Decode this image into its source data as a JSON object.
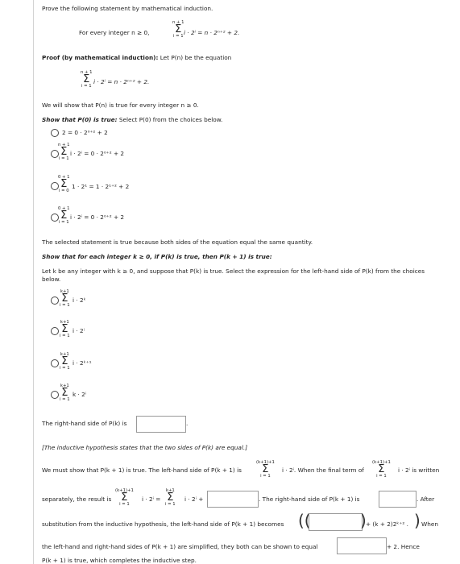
{
  "intro": "Prove the following statement by mathematical induction.",
  "statement": {
    "prefix": "For every integer n ≥ 0,",
    "rhs": "i · 2ⁱ = n · 2ⁿ⁺² + 2."
  },
  "proof_title": "Proof (by mathematical induction):",
  "proof_text": "Let P(n) be the equation",
  "eq_pn": "i · 2ⁱ = n · 2ⁿ⁺² + 2.",
  "we_show": "We will show that P(n) is true for every integer n ≥ 0.",
  "show_p0": {
    "title": "Show that P(0) is true:",
    "text": "Select P(0) from the choices below."
  },
  "p0_choices": [
    {
      "text": "2 = 0 · 2⁰⁺² + 2",
      "selected": false
    },
    {
      "text": "i · 2ⁱ = 0 · 2⁰⁺² + 2",
      "sum_top": "n + 1",
      "sum_bottom": "i = 1",
      "selected": false
    },
    {
      "text": "1 · 2¹ = 1 · 2¹⁺² + 2",
      "sum_top": "0 + 1",
      "sum_bottom": "i = 0",
      "selected": false
    },
    {
      "text": "i · 2ⁱ = 0 · 2⁰⁺² + 2",
      "sum_top": "0 + 1",
      "sum_bottom": "i = 1",
      "selected": false
    }
  ],
  "selected_statement": "The selected statement is true because both sides of the equation equal the same quantity.",
  "show_pk": {
    "title": "Show that for each integer k ≥ 0, if P(k) is true, then P(k + 1) is true:"
  },
  "let_k": "Let k be any integer with k ≥ 0, and suppose that P(k) is true. Select the expression for the left-hand side of P(k) from the choices",
  "let_k2": "below.",
  "pk_choices": [
    {
      "text": "i · 2ᵏ",
      "sum_top": "k+1",
      "sum_bottom": "i = 1",
      "selected": false
    },
    {
      "text": "i · 2ⁱ",
      "sum_top": "k+1",
      "sum_bottom": "i = 1",
      "selected": false
    },
    {
      "text": "i · 2ᵏ⁺¹",
      "sum_top": "k+1",
      "sum_bottom": "i = 1",
      "selected": false
    },
    {
      "text": "k · 2ⁱ",
      "sum_top": "k+1",
      "sum_bottom": "i = 1",
      "selected": false
    }
  ],
  "rhs_label": "The right-hand side of P(k) is",
  "rhs_value": "",
  "inductive_note": "[The inductive hypothesis states that the two sides of P(k) are equal.]",
  "must_show": {
    "part1": "We must show that P(k + 1) is true. The left-hand side of P(k + 1) is",
    "sum1_top": "(k+1)+1",
    "sum1_bottom": "i = 1",
    "part2": "i · 2ⁱ. When the final term of",
    "sum2_top": "(k+1)+1",
    "sum2_bottom": "i = 1",
    "part3": "i · 2ⁱ is written"
  },
  "separately": {
    "part1": "separately, the result is",
    "sumA_top": "(k+1)+1",
    "sumA_bottom": "i = 1",
    "mid": "i · 2ⁱ =",
    "sumB_top": "k+1",
    "sumB_bottom": "i = 1",
    "part2": "i · 2ⁱ +",
    "part3": ". The right-hand side of P(k + 1) is",
    "part4": ". After"
  },
  "substitution": {
    "part1": "substitution from the inductive hypothesis, the left-hand side of P(k + 1) becomes",
    "part2": "+ (k + 2)2ᵏ⁺² .",
    "part3": "When"
  },
  "final": {
    "part1": "the left-hand and right-hand sides of P(k + 1) are simplified, they both can be shown to equal",
    "part2": "+ 2. Hence"
  },
  "conclusion": "P(k + 1) is true, which completes the inductive step."
}
